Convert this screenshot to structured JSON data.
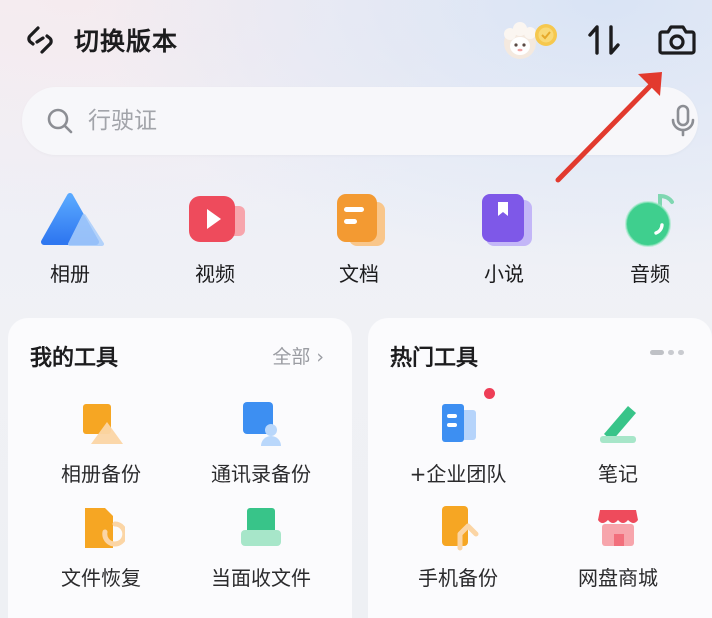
{
  "header": {
    "switch_version_label": "切换版本",
    "icons": [
      "switch-icon",
      "avatar-sheep-icon",
      "sort-icon",
      "camera-icon"
    ]
  },
  "search": {
    "placeholder": "行驶证",
    "icons": [
      "search-icon",
      "microphone-icon"
    ]
  },
  "categories": [
    {
      "label": "相册",
      "icon": "album-icon"
    },
    {
      "label": "视频",
      "icon": "video-icon"
    },
    {
      "label": "文档",
      "icon": "document-icon"
    },
    {
      "label": "小说",
      "icon": "novel-icon"
    },
    {
      "label": "音频",
      "icon": "audio-icon"
    }
  ],
  "my_tools": {
    "title": "我的工具",
    "more_label": "全部 ›",
    "items": [
      {
        "label": "相册备份",
        "icon": "album-backup-icon"
      },
      {
        "label": "通讯录备份",
        "icon": "contacts-backup-icon"
      },
      {
        "label": "文件恢复",
        "icon": "file-restore-icon"
      },
      {
        "label": "当面收文件",
        "icon": "receive-file-icon"
      }
    ]
  },
  "hot_tools": {
    "title": "热门工具",
    "items": [
      {
        "label": "+企业团队",
        "icon": "enterprise-team-icon"
      },
      {
        "label": "笔记",
        "icon": "note-icon"
      },
      {
        "label": "手机备份",
        "icon": "phone-backup-icon"
      },
      {
        "label": "网盘商城",
        "icon": "store-icon"
      }
    ]
  },
  "colors": {
    "accent_red": "#ee3e57",
    "annotation_arrow": "#e23a2e"
  }
}
